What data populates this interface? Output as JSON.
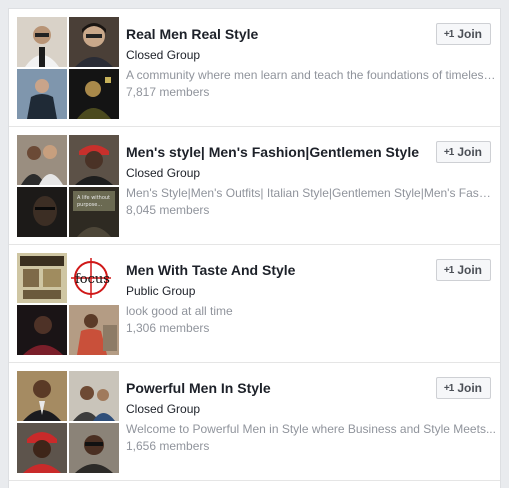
{
  "join_icon": "+1",
  "groups": [
    {
      "name": "Real Men Real Style",
      "type": "Closed Group",
      "description": "A community where men learn and teach the foundations of timeless style and...",
      "members": "7,817 members",
      "join_label": "Join",
      "thumb_colors": [
        "#c7b39e",
        "#6f5d4f",
        "#2c3a48",
        "#3a3b1f"
      ]
    },
    {
      "name": "Men's style| Men's Fashion|Gentlemen Style",
      "type": "Closed Group",
      "description": "Men's Style|Men's Outfits| Italian Style|Gentlemen Style|Men's Fashion...",
      "members": "8,045 members",
      "join_label": "Join",
      "thumb_colors": [
        "#8a7a6a",
        "#b8332f",
        "#2a2420",
        "#3f3a2e"
      ]
    },
    {
      "name": "Men With Taste And Style",
      "type": "Public Group",
      "description": "look good at all time",
      "members": "1,306 members",
      "join_label": "Join",
      "thumb_colors": [
        "#9c8f6a",
        "#f2f2f2",
        "#5a2027",
        "#8c7563"
      ]
    },
    {
      "name": "Powerful Men In Style",
      "type": "Closed Group",
      "description": "Welcome to Powerful Men in Style where Business and Style Meets...",
      "members": "1,656 members",
      "join_label": "Join",
      "thumb_colors": [
        "#6b4d35",
        "#b7b2a8",
        "#4a2d26",
        "#8a8277"
      ]
    }
  ]
}
